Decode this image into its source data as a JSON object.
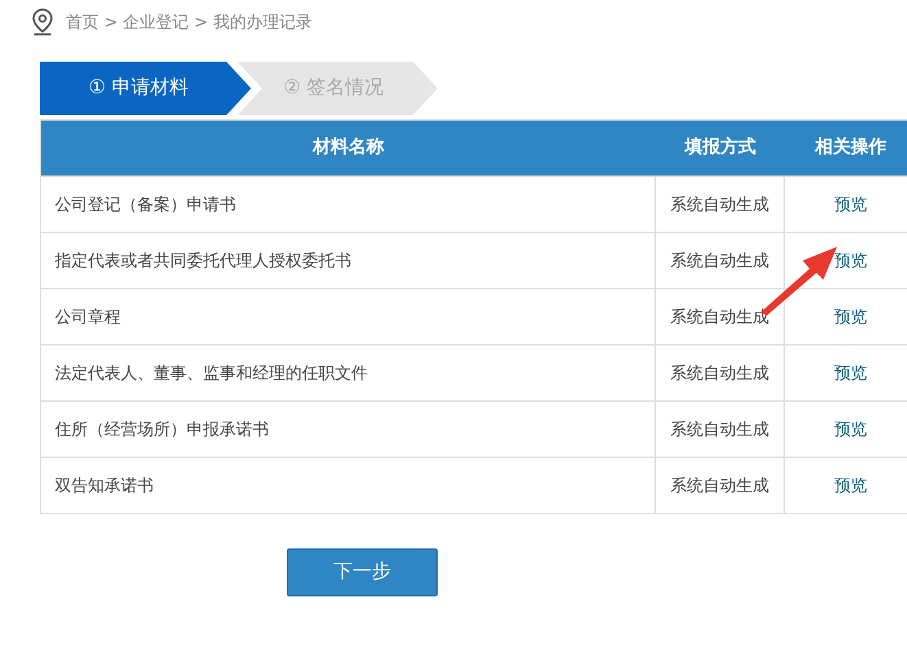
{
  "breadcrumb": "首页 > 企业登记 > 我的办理记录",
  "steps": [
    {
      "label": "① 申请材料",
      "selected": true
    },
    {
      "label": "② 签名情况",
      "selected": false
    }
  ],
  "table": {
    "columns": [
      "材料名称",
      "填报方式",
      "相关操作"
    ],
    "rows": [
      {
        "name": "公司登记（备案）申请书",
        "method": "系统自动生成",
        "action": "预览"
      },
      {
        "name": "指定代表或者共同委托代理人授权委托书",
        "method": "系统自动生成",
        "action": "预览"
      },
      {
        "name": "公司章程",
        "method": "系统自动生成",
        "action": "预览"
      },
      {
        "name": "法定代表人、董事、监事和经理的任职文件",
        "method": "系统自动生成",
        "action": "预览"
      },
      {
        "name": "住所（经营场所）申报承诺书",
        "method": "系统自动生成",
        "action": "预览"
      },
      {
        "name": "双告知承诺书",
        "method": "系统自动生成",
        "action": "预览"
      }
    ]
  },
  "next_button": "下一步"
}
